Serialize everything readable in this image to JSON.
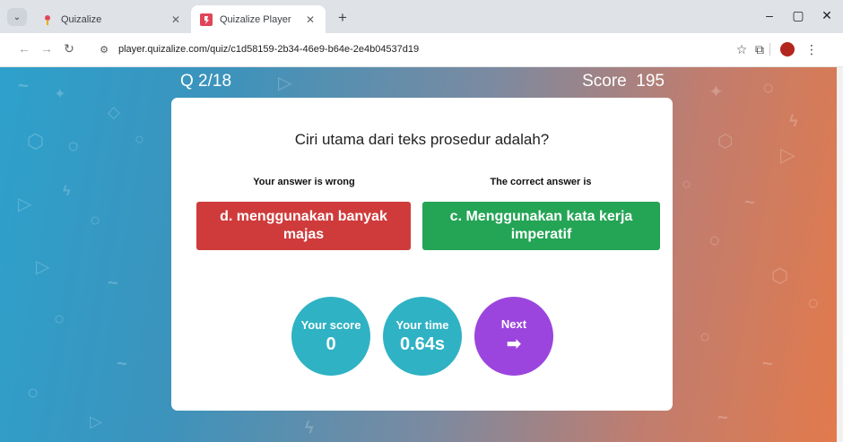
{
  "browser": {
    "tabs": [
      {
        "title": "Quizalize",
        "active": false
      },
      {
        "title": "Quizalize Player",
        "active": true
      }
    ],
    "url": "player.quizalize.com/quiz/c1d58159-2b34-46e9-b64e-2e4b04537d19"
  },
  "quiz": {
    "counter": "Q 2/18",
    "score_label": "Score",
    "score_value": "195",
    "question": "Ciri utama dari teks prosedur adalah?",
    "your_answer_label": "Your answer is wrong",
    "your_answer": "d. menggunakan banyak majas",
    "correct_label": "The correct answer is",
    "correct_answer": "c. Menggunakan kata kerja imperatif",
    "your_score_label": "Your score",
    "your_score_value": "0",
    "your_time_label": "Your time",
    "your_time_value": "0.64s",
    "next_label": "Next"
  },
  "colors": {
    "wrong": "#cf3b3b",
    "correct": "#24a455",
    "stat_circle": "#2fb2c4",
    "next_button": "#9b45de"
  },
  "icons": [
    "tab-list-icon",
    "quizalize-favicon",
    "close-icon",
    "new-tab-icon",
    "minimize-icon",
    "restore-icon",
    "window-close-icon",
    "back-arrow-icon",
    "forward-arrow-icon",
    "reload-icon",
    "site-info-icon",
    "bookmark-star-icon",
    "extensions-icon",
    "profile-avatar",
    "more-menu-icon",
    "right-arrow-icon"
  ]
}
